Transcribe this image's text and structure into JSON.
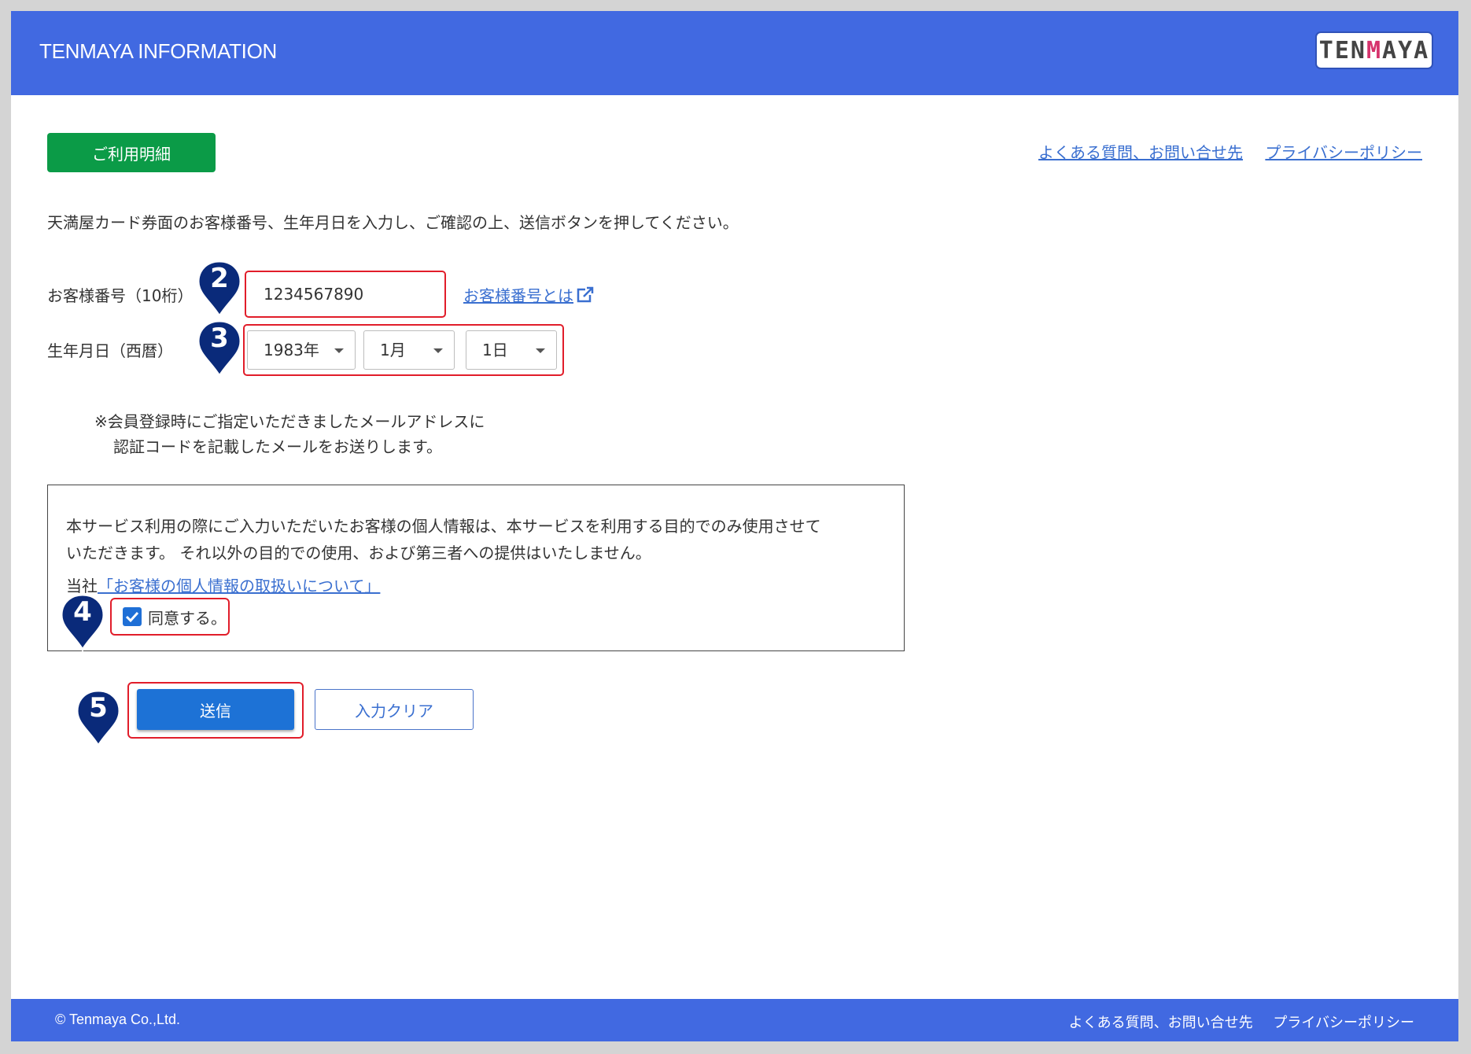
{
  "header": {
    "title": "TENMAYA INFORMATION",
    "logo_text": [
      "TEN",
      "M",
      "AYA"
    ]
  },
  "nav": {
    "usage_button": "ご利用明細",
    "links": [
      "よくある質問、お問い合せ先",
      "プライバシーポリシー"
    ]
  },
  "intro": "天満屋カード券面のお客様番号、生年月日を入力し、ご確認の上、送信ボタンを押してください。",
  "form": {
    "customer_number_label": "お客様番号（10桁）",
    "customer_number_value": "1234567890",
    "customer_number_help": "お客様番号とは",
    "dob_label": "生年月日（西暦）",
    "dob_year": "1983年",
    "dob_month": "1月",
    "dob_day": "1日"
  },
  "note": {
    "line1": "※会員登録時にご指定いただきましたメールアドレスに",
    "line2": "認証コードを記載したメールをお送りします。"
  },
  "privacy": {
    "line1": "本サービス利用の際にご入力いただいたお客様の個人情報は、本サービスを利用する目的でのみ使用させて",
    "line2": "いただきます。 それ以外の目的での使用、および第三者への提供はいたしません。",
    "company_prefix": "当社",
    "company_link": "「お客様の個人情報の取扱いについて」",
    "agree_label": "同意する。",
    "agree_checked": true
  },
  "buttons": {
    "submit": "送信",
    "clear": "入力クリア"
  },
  "markers": [
    "2",
    "3",
    "4",
    "5"
  ],
  "footer": {
    "copyright": "© Tenmaya Co.,Ltd.",
    "links": [
      "よくある質問、お問い合せ先",
      "プライバシーポリシー"
    ]
  },
  "colors": {
    "header": "#4169e1",
    "usage_button": "#0b9b47",
    "primary": "#1d72d6",
    "highlight": "#e11d2a",
    "marker": "#0a2a7a"
  }
}
